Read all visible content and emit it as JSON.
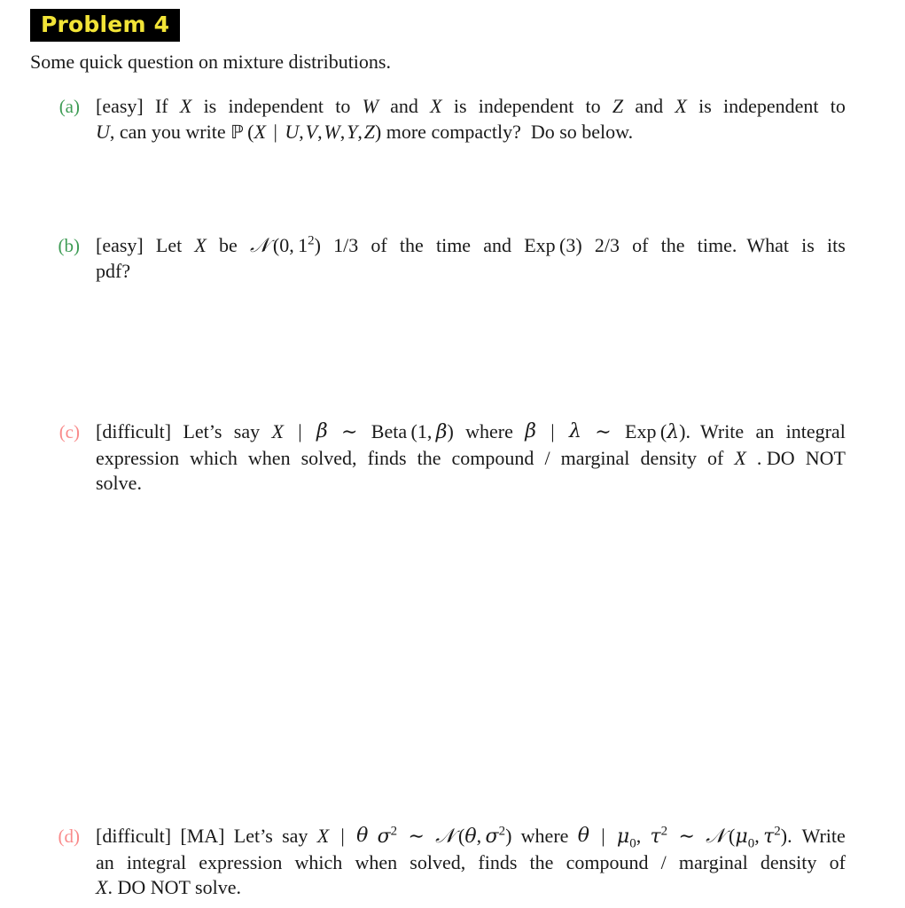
{
  "document": {
    "problem_title": "Problem 4",
    "intro": "Some quick question on mixture distributions.",
    "title_bg_color": "#000000",
    "title_text_color": "#f2e437",
    "easy_label_color": "#3e9c55",
    "difficult_label_color": "#f98a8a",
    "page_background": "#ffffff",
    "body_text_color": "#1a1a1a"
  },
  "items": [
    {
      "label": "(a)",
      "difficulty": "[easy]",
      "difficulty_color": "#3e9c55",
      "text": "[easy] If X is independent to W and X is independent to Z and X is independent to U, can you write P (X | U, V, W, Y, Z) more compactly? Do so below.",
      "lines": [
        "[easy] If X is independent to W and X is independent to Z and X is independent to",
        "U, can you write P (X | U, V, W, Y, Z) more compactly? Do so below."
      ]
    },
    {
      "label": "(b)",
      "difficulty": "[easy]",
      "difficulty_color": "#3e9c55",
      "text": "[easy] Let X be N (0, 1^2) 1/3 of the time and Exp (3) 2/3 of the time. What is its pdf?",
      "lines": [
        "[easy] Let X be N (0, 1²) 1/3 of the time and Exp (3) 2/3 of the time.  What is its",
        "pdf?"
      ]
    },
    {
      "label": "(c)",
      "difficulty": "[difficult]",
      "difficulty_color": "#f98a8a",
      "text": "[difficult] Let's say X | β ~ Beta (1, β) where β | λ ~ Exp (λ). Write an integral expression which when solved, finds the compound / marginal density of X. DO NOT solve.",
      "lines": [
        "[difficult] Let's say X | β ~ Beta (1, β) where β | λ ~ Exp (λ).  Write an integral",
        "expression which when solved, finds the compound / marginal density of X. DO NOT",
        "solve."
      ]
    },
    {
      "label": "(d)",
      "difficulty": "[difficult]",
      "extra_tag": "[MA]",
      "difficulty_color": "#f98a8a",
      "text": "[difficult] [MA] Let's say X | θ, σ² ~ N (θ, σ²) where θ | μ₀, τ² ~ N (μ₀, τ²). Write an integral expression which when solved, finds the compound / marginal density of X. DO NOT solve.",
      "lines": [
        "[difficult] [MA] Let's say X | θ, σ² ~ N (θ, σ²) where θ | μ₀, τ² ~ N (μ₀, τ²).  Write",
        "an integral expression which when solved, finds the compound / marginal density of",
        "X. DO NOT solve."
      ]
    }
  ]
}
